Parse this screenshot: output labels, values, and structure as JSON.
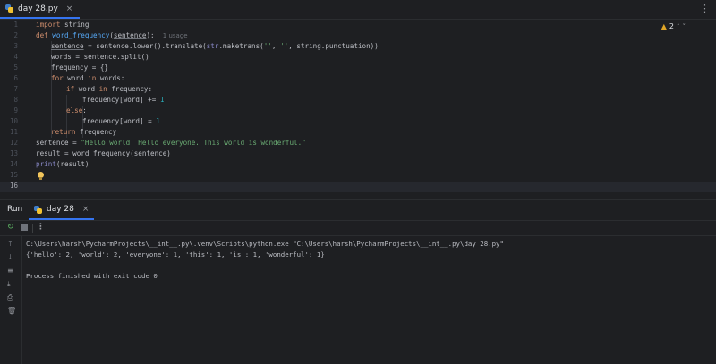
{
  "editor_tab": {
    "filename": "day 28.py",
    "close": "×"
  },
  "inspections": {
    "warning_count": "2",
    "warning_icon": "warning-triangle-icon"
  },
  "gutter": {
    "line_numbers": [
      "1",
      "2",
      "3",
      "4",
      "5",
      "6",
      "7",
      "8",
      "9",
      "10",
      "11",
      "12",
      "13",
      "14",
      "15",
      "16"
    ],
    "current_line": "16"
  },
  "code": {
    "l1_kw": "import",
    "l1_mod": " string",
    "l2_kw": "def",
    "l2_fn": "word_frequency",
    "l2_p1": "(",
    "l2_param": "sentence",
    "l2_p2": "):",
    "l2_hint": "1 usage",
    "l3_var": "sentence",
    "l3_a": " = sentence.lower().translate(",
    "l3_bi": "str",
    "l3_b": ".maketrans(",
    "l3_s1": "''",
    "l3_c1": ", ",
    "l3_s2": "''",
    "l3_c2": ", string.punctuation))",
    "l4": "words = sentence.split()",
    "l5": "frequency = {}",
    "l6_kw1": "for",
    "l6_a": " word ",
    "l6_kw2": "in",
    "l6_b": " words:",
    "l7_kw1": "if",
    "l7_a": " word ",
    "l7_kw2": "in",
    "l7_b": " frequency:",
    "l8_a": "frequency[word] += ",
    "l8_n": "1",
    "l9_kw": "else",
    "l9_b": ":",
    "l10_a": "frequency[word] = ",
    "l10_n": "1",
    "l11_kw": "return",
    "l11_b": " frequency",
    "l12_a": "sentence = ",
    "l12_s": "\"Hello world! Hello everyone. This world is wonderful.\"",
    "l13": "result = word_frequency(sentence)",
    "l14_bi": "print",
    "l14_b": "(result)"
  },
  "run_panel": {
    "label": "Run",
    "tab": "day 28",
    "close": "×",
    "more": "⋮",
    "console": [
      "C:\\Users\\harsh\\PycharmProjects\\__int__.py\\.venv\\Scripts\\python.exe \"C:\\Users\\harsh\\PycharmProjects\\__int__.py\\day 28.py\"",
      "{'hello': 2, 'world': 2, 'everyone': 1, 'this': 1, 'is': 1, 'wonderful': 1}",
      "",
      "Process finished with exit code 0"
    ]
  }
}
